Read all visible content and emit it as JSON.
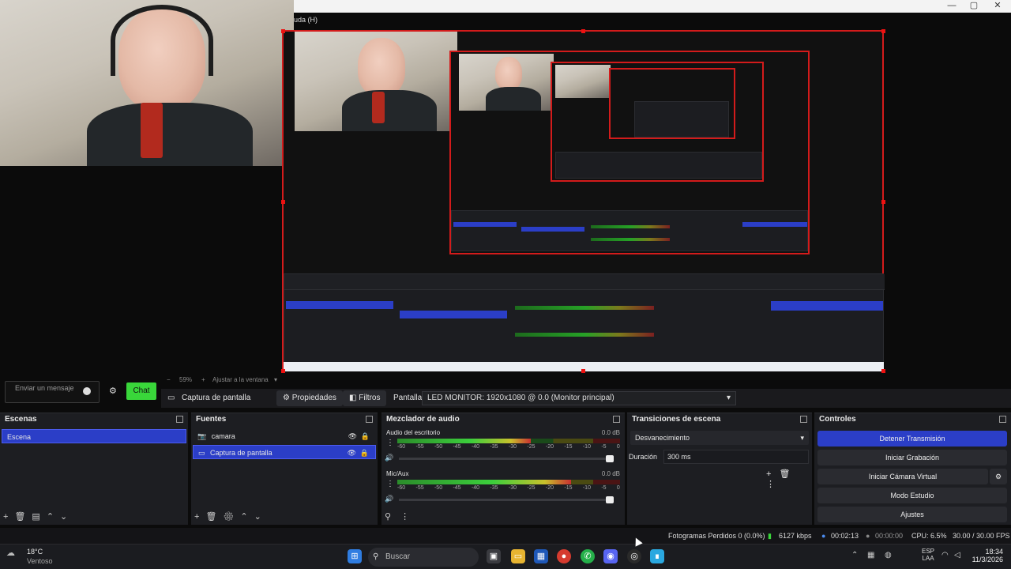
{
  "window": {
    "title_fragment": "uda (H)",
    "controls": [
      "—",
      "▢",
      "✕"
    ]
  },
  "preview": {
    "zoom": "59%",
    "fit_label": "Ajustar a la ventana"
  },
  "chat": {
    "placeholder": "Enviar un mensaje",
    "button_label": "Chat"
  },
  "context_bar": {
    "source_name": "Captura de pantalla",
    "properties_label": "Propiedades",
    "filters_label": "Filtros",
    "display_label": "Pantalla",
    "display_value": "LED MONITOR: 1920x1080 @ 0.0 (Monitor principal)"
  },
  "scenes": {
    "title": "Escenas",
    "items": [
      "Escena"
    ]
  },
  "sources": {
    "title": "Fuentes",
    "items": [
      {
        "label": "camara",
        "icon": "camera-icon"
      },
      {
        "label": "Captura de pantalla",
        "icon": "monitor-icon"
      }
    ]
  },
  "mixer": {
    "title": "Mezclador de audio",
    "ticks": [
      "-60",
      "-55",
      "-50",
      "-45",
      "-40",
      "-35",
      "-30",
      "-25",
      "-20",
      "-15",
      "-10",
      "-5",
      "0"
    ],
    "channels": [
      {
        "name": "Audio del escritorio",
        "db": "0.0 dB",
        "level_fraction": 0.6
      },
      {
        "name": "Mic/Aux",
        "db": "0.0 dB",
        "level_fraction": 0.78
      }
    ]
  },
  "transitions": {
    "title": "Transiciones de escena",
    "selected": "Desvanecimiento",
    "duration_label": "Duración",
    "duration_value": "300 ms"
  },
  "controls": {
    "title": "Controles",
    "buttons": [
      "Detener Transmisión",
      "Iniciar Grabación",
      "Iniciar Cámara Virtual",
      "Modo Estudio",
      "Ajustes"
    ]
  },
  "status": {
    "dropped_frames": "Fotogramas Perdidos 0 (0.0%)",
    "bitrate": "6127 kbps",
    "stream_time": "00:02:13",
    "record_time": "00:00:00",
    "cpu": "CPU: 6.5%",
    "fps": "30.00 / 30.00 FPS"
  },
  "taskbar": {
    "weather_temp": "18°C",
    "weather_desc": "Ventoso",
    "search_placeholder": "Buscar",
    "lang_top": "ESP",
    "lang_bottom": "LAA",
    "time": "18:34",
    "date": "11/3/2026"
  },
  "colors": {
    "accent_blue": "#2b3ec7",
    "chat_green": "#39d63a",
    "selection_red": "#d31b1b"
  }
}
